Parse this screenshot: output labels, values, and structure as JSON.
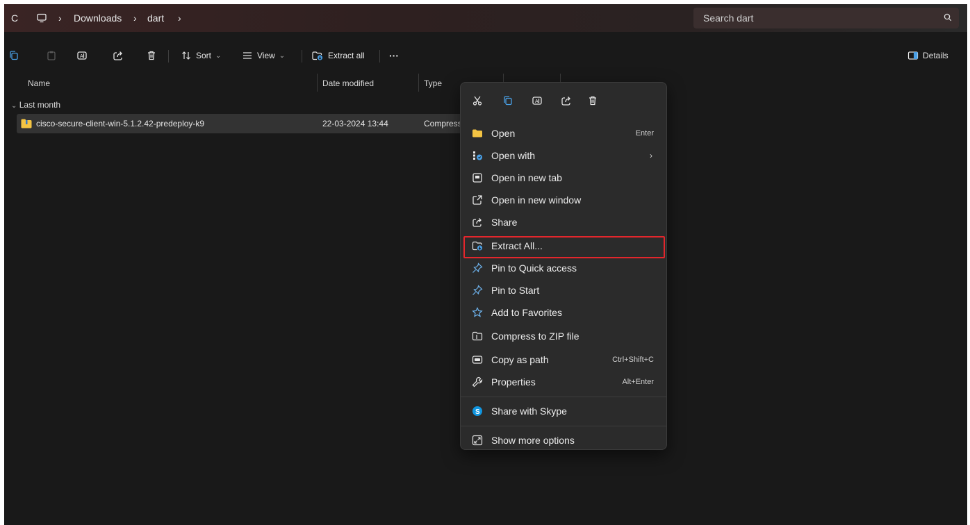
{
  "addressbar": {
    "refresh_glyph": "C",
    "crumbs": [
      "Downloads",
      "dart"
    ],
    "separator": "›",
    "search_placeholder": "Search dart"
  },
  "toolbar": {
    "sort_label": "Sort",
    "view_label": "View",
    "extract_label": "Extract all",
    "more_label": "···",
    "details_label": "Details",
    "chevron": "⌄"
  },
  "columns": {
    "name": "Name",
    "date": "Date modified",
    "type": "Type"
  },
  "group": {
    "label": "Last month",
    "chevron": "⌄"
  },
  "file": {
    "name": "cisco-secure-client-win-5.1.2.42-predeploy-k9",
    "date": "22-03-2024 13:44",
    "type": "Compress"
  },
  "context_menu": {
    "items": [
      {
        "label": "Open",
        "shortcut": "Enter",
        "icon": "folder-icon"
      },
      {
        "label": "Open with",
        "arrow": "›",
        "icon": "open-with-icon"
      },
      {
        "label": "Open in new tab",
        "icon": "new-tab-icon"
      },
      {
        "label": "Open in new window",
        "icon": "new-window-icon"
      },
      {
        "label": "Share",
        "icon": "share-icon"
      },
      {
        "label": "Extract All...",
        "icon": "extract-icon"
      },
      {
        "label": "Pin to Quick access",
        "icon": "pin-icon"
      },
      {
        "label": "Pin to Start",
        "icon": "pin-icon"
      },
      {
        "label": "Add to Favorites",
        "icon": "star-icon"
      },
      {
        "label": "Compress to ZIP file",
        "icon": "zip-icon"
      },
      {
        "label": "Copy as path",
        "shortcut": "Ctrl+Shift+C",
        "icon": "copy-path-icon"
      },
      {
        "label": "Properties",
        "shortcut": "Alt+Enter",
        "icon": "wrench-icon"
      },
      {
        "label": "Share with Skype",
        "icon": "skype-icon"
      },
      {
        "label": "Show more options",
        "icon": "more-options-icon"
      }
    ]
  },
  "colors": {
    "highlight_border": "#e3262c",
    "menu_bg": "#2b2b2b",
    "window_bg": "#191919",
    "folder_yellow": "#f4c443",
    "accent_blue": "#4aa0e6",
    "skype_blue": "#1196e0"
  }
}
